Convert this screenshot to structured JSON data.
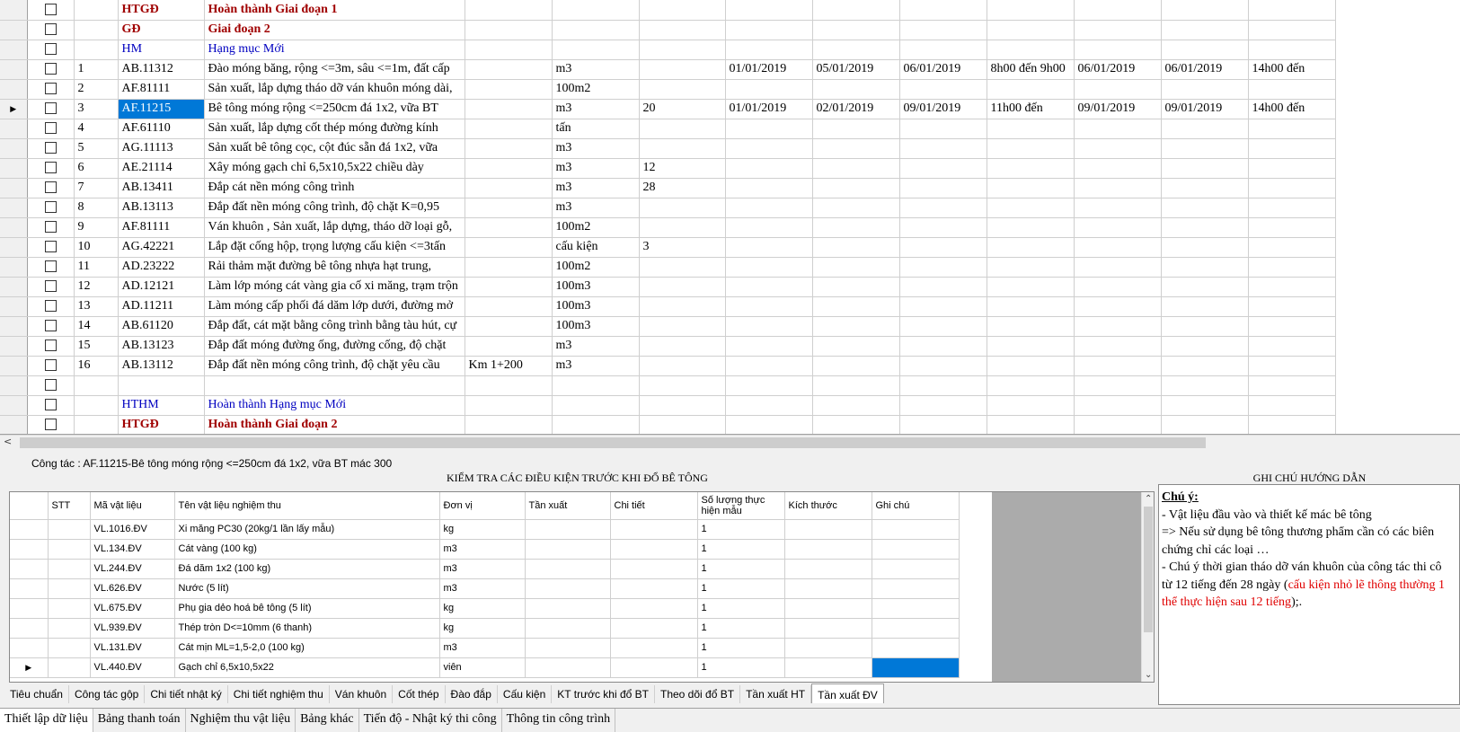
{
  "top_grid": {
    "rows": [
      {
        "marker": "",
        "stt": "",
        "code": "HTGĐ",
        "name": "Hoàn thành Giai đoạn 1",
        "loc": "",
        "unit": "",
        "qty": "",
        "d1": "",
        "d2": "",
        "d3": "",
        "t1": "",
        "d4": "",
        "d5": "",
        "t2": "",
        "style": "red"
      },
      {
        "marker": "",
        "stt": "",
        "code": "GĐ",
        "name": "Giai đoạn 2",
        "loc": "",
        "unit": "",
        "qty": "",
        "d1": "",
        "d2": "",
        "d3": "",
        "t1": "",
        "d4": "",
        "d5": "",
        "t2": "",
        "style": "red"
      },
      {
        "marker": "",
        "stt": "",
        "code": "HM",
        "name": "Hạng mục Mới",
        "loc": "",
        "unit": "",
        "qty": "",
        "d1": "",
        "d2": "",
        "d3": "",
        "t1": "",
        "d4": "",
        "d5": "",
        "t2": "",
        "style": "blue"
      },
      {
        "marker": "",
        "stt": "1",
        "code": "AB.11312",
        "name": "Đào móng băng, rộng <=3m, sâu <=1m, đất cấp",
        "loc": "",
        "unit": "m3",
        "qty": "",
        "d1": "01/01/2019",
        "d2": "05/01/2019",
        "d3": "06/01/2019",
        "t1": "8h00 đến 9h00",
        "d4": "06/01/2019",
        "d5": "06/01/2019",
        "t2": "14h00 đến",
        "style": ""
      },
      {
        "marker": "",
        "stt": "2",
        "code": "AF.81111",
        "name": "Sản xuất, lắp dựng tháo dỡ ván khuôn móng dài,",
        "loc": "",
        "unit": "100m2",
        "qty": "",
        "d1": "",
        "d2": "",
        "d3": "",
        "t1": "",
        "d4": "",
        "d5": "",
        "t2": "",
        "style": ""
      },
      {
        "marker": "▶",
        "stt": "3",
        "code": "AF.11215",
        "name": "Bê tông móng rộng <=250cm đá 1x2, vữa BT",
        "loc": "",
        "unit": "m3",
        "qty": "20",
        "d1": "01/01/2019",
        "d2": "02/01/2019",
        "d3": "09/01/2019",
        "t1": "11h00 đến",
        "d4": "09/01/2019",
        "d5": "09/01/2019",
        "t2": "14h00 đến",
        "style": "selected"
      },
      {
        "marker": "",
        "stt": "4",
        "code": "AF.61110",
        "name": "Sản xuất, lắp dựng cốt thép móng đường kính",
        "loc": "",
        "unit": "tấn",
        "qty": "",
        "d1": "",
        "d2": "",
        "d3": "",
        "t1": "",
        "d4": "",
        "d5": "",
        "t2": "",
        "style": ""
      },
      {
        "marker": "",
        "stt": "5",
        "code": "AG.11113",
        "name": "Sản xuất bê tông cọc, cột đúc sẵn đá 1x2, vữa",
        "loc": "",
        "unit": "m3",
        "qty": "",
        "d1": "",
        "d2": "",
        "d3": "",
        "t1": "",
        "d4": "",
        "d5": "",
        "t2": "",
        "style": ""
      },
      {
        "marker": "",
        "stt": "6",
        "code": "AE.21114",
        "name": "Xây móng gạch chỉ 6,5x10,5x22 chiều dày",
        "loc": "",
        "unit": "m3",
        "qty": "12",
        "d1": "",
        "d2": "",
        "d3": "",
        "t1": "",
        "d4": "",
        "d5": "",
        "t2": "",
        "style": ""
      },
      {
        "marker": "",
        "stt": "7",
        "code": "AB.13411",
        "name": "Đắp cát nền móng công trình",
        "loc": "",
        "unit": "m3",
        "qty": "28",
        "d1": "",
        "d2": "",
        "d3": "",
        "t1": "",
        "d4": "",
        "d5": "",
        "t2": "",
        "style": ""
      },
      {
        "marker": "",
        "stt": "8",
        "code": "AB.13113",
        "name": "Đắp đất nền móng công trình, độ chặt K=0,95",
        "loc": "",
        "unit": "m3",
        "qty": "",
        "d1": "",
        "d2": "",
        "d3": "",
        "t1": "",
        "d4": "",
        "d5": "",
        "t2": "",
        "style": ""
      },
      {
        "marker": "",
        "stt": "9",
        "code": "AF.81111",
        "name": "Ván khuôn , Sản xuất, lắp dựng, tháo dỡ loại gỗ,",
        "loc": "",
        "unit": "100m2",
        "qty": "",
        "d1": "",
        "d2": "",
        "d3": "",
        "t1": "",
        "d4": "",
        "d5": "",
        "t2": "",
        "style": ""
      },
      {
        "marker": "",
        "stt": "10",
        "code": "AG.42221",
        "name": "Lắp đặt cống hộp, trọng lượng cấu kiện <=3tấn",
        "loc": "",
        "unit": "cấu kiện",
        "qty": "3",
        "d1": "",
        "d2": "",
        "d3": "",
        "t1": "",
        "d4": "",
        "d5": "",
        "t2": "",
        "style": ""
      },
      {
        "marker": "",
        "stt": "11",
        "code": "AD.23222",
        "name": "Rải thảm mặt đường bê tông nhựa hạt trung,",
        "loc": "",
        "unit": "100m2",
        "qty": "",
        "d1": "",
        "d2": "",
        "d3": "",
        "t1": "",
        "d4": "",
        "d5": "",
        "t2": "",
        "style": ""
      },
      {
        "marker": "",
        "stt": "12",
        "code": "AD.12121",
        "name": "Làm lớp móng cát vàng gia cố xi măng, trạm trộn",
        "loc": "",
        "unit": "100m3",
        "qty": "",
        "d1": "",
        "d2": "",
        "d3": "",
        "t1": "",
        "d4": "",
        "d5": "",
        "t2": "",
        "style": ""
      },
      {
        "marker": "",
        "stt": "13",
        "code": "AD.11211",
        "name": "Làm móng cấp phối đá dăm lớp dưới, đường mở",
        "loc": "",
        "unit": "100m3",
        "qty": "",
        "d1": "",
        "d2": "",
        "d3": "",
        "t1": "",
        "d4": "",
        "d5": "",
        "t2": "",
        "style": ""
      },
      {
        "marker": "",
        "stt": "14",
        "code": "AB.61120",
        "name": "Đắp đất, cát mặt bằng công trình bằng tàu hút, cự",
        "loc": "",
        "unit": "100m3",
        "qty": "",
        "d1": "",
        "d2": "",
        "d3": "",
        "t1": "",
        "d4": "",
        "d5": "",
        "t2": "",
        "style": ""
      },
      {
        "marker": "",
        "stt": "15",
        "code": "AB.13123",
        "name": "Đắp đất móng đường ống, đường cống, độ chặt",
        "loc": "",
        "unit": "m3",
        "qty": "",
        "d1": "",
        "d2": "",
        "d3": "",
        "t1": "",
        "d4": "",
        "d5": "",
        "t2": "",
        "style": ""
      },
      {
        "marker": "",
        "stt": "16",
        "code": "AB.13112",
        "name": "Đắp đất nền móng công trình, độ chặt yêu cầu",
        "loc": "Km 1+200",
        "unit": "m3",
        "qty": "",
        "d1": "",
        "d2": "",
        "d3": "",
        "t1": "",
        "d4": "",
        "d5": "",
        "t2": "",
        "style": ""
      },
      {
        "marker": "",
        "stt": "",
        "code": "",
        "name": "",
        "loc": "",
        "unit": "",
        "qty": "",
        "d1": "",
        "d2": "",
        "d3": "",
        "t1": "",
        "d4": "",
        "d5": "",
        "t2": "",
        "style": ""
      },
      {
        "marker": "",
        "stt": "",
        "code": "HTHM",
        "name": "Hoàn thành Hạng mục Mới",
        "loc": "",
        "unit": "",
        "qty": "",
        "d1": "",
        "d2": "",
        "d3": "",
        "t1": "",
        "d4": "",
        "d5": "",
        "t2": "",
        "style": "blue"
      },
      {
        "marker": "",
        "stt": "",
        "code": "HTGĐ",
        "name": "Hoàn thành Giai đoạn 2",
        "loc": "",
        "unit": "",
        "qty": "",
        "d1": "",
        "d2": "",
        "d3": "",
        "t1": "",
        "d4": "",
        "d5": "",
        "t2": "",
        "style": "red"
      }
    ]
  },
  "scroll_left_arrow": "<",
  "info_line": "Công tác :  AF.11215-Bê tông móng rộng <=250cm đá 1x2, vữa BT mác 300",
  "check_title": "KIỂM TRA CÁC ĐIỀU KIỆN TRƯỚC KHI ĐỔ BÊ TÔNG",
  "notes_title": "GHI CHÚ HƯỚNG DẪN",
  "materials": {
    "headers": [
      "STT",
      "Mã vật liệu",
      "Tên vật liệu nghiệm thu",
      "Đơn vị",
      "Tần xuất",
      "Chi tiết",
      "Số lượng thực hiện mẫu",
      "Kích thước",
      "Ghi chú"
    ],
    "rows": [
      {
        "marker": "",
        "code": "VL.1016.ĐV",
        "name": "Xi măng PC30 (20kg/1 lần lấy mẫu)",
        "unit": "kg",
        "qty": "1"
      },
      {
        "marker": "",
        "code": "VL.134.ĐV",
        "name": "Cát vàng (100 kg)",
        "unit": "m3",
        "qty": "1"
      },
      {
        "marker": "",
        "code": "VL.244.ĐV",
        "name": "Đá dăm 1x2 (100 kg)",
        "unit": "m3",
        "qty": "1"
      },
      {
        "marker": "",
        "code": "VL.626.ĐV",
        "name": "Nước (5 lít)",
        "unit": "m3",
        "qty": "1"
      },
      {
        "marker": "",
        "code": "VL.675.ĐV",
        "name": "Phụ gia dẻo hoá bê tông (5 lít)",
        "unit": "kg",
        "qty": "1"
      },
      {
        "marker": "",
        "code": "VL.939.ĐV",
        "name": "Thép tròn D<=10mm (6 thanh)",
        "unit": "kg",
        "qty": "1"
      },
      {
        "marker": "",
        "code": "VL.131.ĐV",
        "name": "Cát mịn ML=1,5-2,0 (100 kg)",
        "unit": "m3",
        "qty": "1"
      },
      {
        "marker": "▶",
        "code": "VL.440.ĐV",
        "name": "Gạch chỉ 6,5x10,5x22",
        "unit": "viên",
        "qty": "1"
      }
    ]
  },
  "notes": {
    "heading": "Chú ý:",
    "l1": "- Vật liệu đầu vào và thiết kế mác bê tông",
    "l2": "=> Nếu sử dụng bê tông thương phẩm cần có các biên",
    "l3": "chứng chỉ các loại …",
    "l4": "- Chú ý thời gian tháo dỡ ván khuôn của công tác thi cô",
    "l5a": "từ 12 tiếng đến 28 ngày (",
    "l5b": "cấu kiện nhỏ lẽ thông thường 1",
    "l6a": "thể thực hiện sau 12 tiếng",
    "l6b": ");."
  },
  "inner_tabs": [
    "Tiêu chuẩn",
    "Công tác gộp",
    "Chi tiết nhật ký",
    "Chi tiết nghiệm thu",
    "Ván khuôn",
    "Cốt thép",
    "Đào đắp",
    "Cấu kiện",
    "KT trước khi đổ BT",
    "Theo dõi đổ BT",
    "Tần xuất HT",
    "Tần xuất ĐV"
  ],
  "inner_tab_active": "Tần xuất ĐV",
  "bottom_tabs": [
    "Thiết lập dữ liệu",
    "Bảng thanh toán",
    "Nghiệm thu vật liệu",
    "Bảng khác",
    "Tiến độ - Nhật ký thi công",
    "Thông tin công trình"
  ],
  "bottom_tab_active": "Thiết lập dữ liệu",
  "colors": {
    "selection": "#0078d7",
    "section_red": "#a00000",
    "section_blue": "#0000c0",
    "note_red": "#e00000"
  }
}
